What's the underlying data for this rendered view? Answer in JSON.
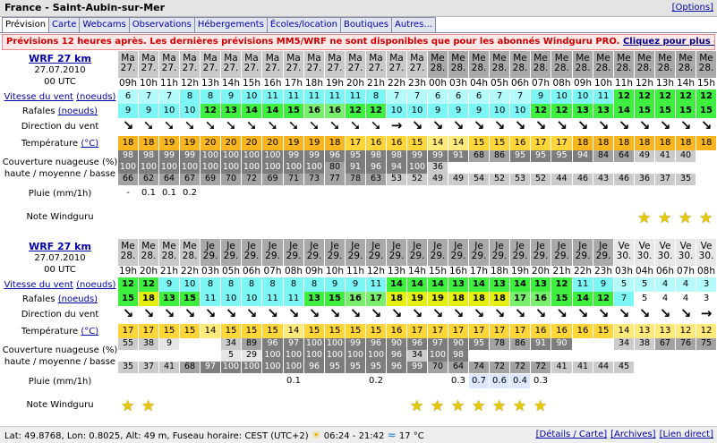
{
  "header": {
    "title": "France - Saint-Aubin-sur-Mer",
    "options_link": "[Options]"
  },
  "tabs": [
    "Prévision",
    "Carte",
    "Webcams",
    "Observations",
    "Hébergements",
    "Écoles/location",
    "Boutiques",
    "Autres..."
  ],
  "notice": {
    "text": "Prévisions 12 heures après. Les dernières prévisions MM5/WRF ne sont disponibles que pour les abonnés Windguru PRO. ",
    "link": "Cliquez pour plus d'info."
  },
  "labels": {
    "model": "WRF 27 km",
    "date": "27.07.2010",
    "run": "00 UTC",
    "wind_speed": "Vitesse du vent",
    "wind_unit": "(noeuds)",
    "gusts": "Rafales",
    "gusts_unit": "(noeuds)",
    "direction": "Direction du vent",
    "temperature": "Température",
    "temp_unit": "(°C)",
    "cloud_line1": "Couverture nuageuse (%)",
    "cloud_line2": "haute / moyenne / basse",
    "rain": "Pluie (mm/1h)",
    "rating": "Note Windguru"
  },
  "colors": {
    "wind_cyan": "#7cf5f5",
    "wind_light": "#b5fbfb",
    "wind_green": "#3fef3f",
    "wind_lime": "#79f06d",
    "gust_yellow": "#e6f00e",
    "temp_orange": "#f7b51f",
    "temp_yellow": "#ffd639",
    "cloud_dark": "#7d7d7d",
    "cloud_mid": "#a2a2a2",
    "cloud_light": "#cbcbcb",
    "star": "#e6c800"
  },
  "forecast1": {
    "days": [
      "Ma",
      "Ma",
      "Ma",
      "Ma",
      "Ma",
      "Ma",
      "Ma",
      "Ma",
      "Ma",
      "Ma",
      "Ma",
      "Ma",
      "Ma",
      "Ma",
      "Ma",
      "Me",
      "Me",
      "Me",
      "Me",
      "Me",
      "Me",
      "Me",
      "Me",
      "Me",
      "Me",
      "Me",
      "Me",
      "Me",
      "Me"
    ],
    "dates": [
      "27.",
      "27.",
      "27.",
      "27.",
      "27.",
      "27.",
      "27.",
      "27.",
      "27.",
      "27.",
      "27.",
      "27.",
      "27.",
      "27.",
      "27.",
      "28.",
      "28.",
      "28.",
      "28.",
      "28.",
      "28.",
      "28.",
      "28.",
      "28.",
      "28.",
      "28.",
      "28.",
      "28.",
      "28."
    ],
    "hours": [
      "09h",
      "10h",
      "11h",
      "12h",
      "13h",
      "14h",
      "15h",
      "16h",
      "17h",
      "18h",
      "19h",
      "20h",
      "21h",
      "22h",
      "23h",
      "00h",
      "03h",
      "04h",
      "05h",
      "06h",
      "07h",
      "08h",
      "09h",
      "10h",
      "11h",
      "12h",
      "13h",
      "14h",
      "15h"
    ],
    "wind": [
      "6",
      "7",
      "7",
      "8",
      "8",
      "9",
      "10",
      "11",
      "11",
      "11",
      "11",
      "11",
      "8",
      "7",
      "7",
      "6",
      "6",
      "6",
      "7",
      "7",
      "9",
      "10",
      "10",
      "11",
      "12",
      "12",
      "12",
      "12",
      "12"
    ],
    "gusts": [
      "9",
      "9",
      "10",
      "10",
      "12",
      "13",
      "14",
      "14",
      "15",
      "16",
      "16",
      "12",
      "12",
      "10",
      "10",
      "9",
      "9",
      "9",
      "10",
      "10",
      "12",
      "12",
      "13",
      "13",
      "14",
      "15",
      "15",
      "15",
      "15"
    ],
    "directions": [
      "↘",
      "➘",
      "➘",
      "➘",
      "➘",
      "➘",
      "➘",
      "➘",
      "➘",
      "➘",
      "➘",
      "➘",
      "➘",
      "→",
      "↘",
      "↘",
      "↘",
      "↘",
      "↘",
      "↘",
      "↘",
      "↘",
      "↘",
      "↘",
      "↘",
      "↘",
      "↘",
      "↘",
      "↘"
    ],
    "temperature": [
      "18",
      "18",
      "19",
      "19",
      "20",
      "20",
      "20",
      "20",
      "19",
      "19",
      "18",
      "17",
      "16",
      "16",
      "15",
      "14",
      "14",
      "15",
      "15",
      "16",
      "17",
      "17",
      "18",
      "18",
      "18",
      "18",
      "18",
      "18",
      "18"
    ],
    "cloud_high": [
      "98",
      "98",
      "99",
      "99",
      "100",
      "100",
      "100",
      "100",
      "99",
      "99",
      "96",
      "95",
      "98",
      "98",
      "99",
      "99",
      "91",
      "68",
      "86",
      "95",
      "95",
      "95",
      "94",
      "84",
      "64",
      "49",
      "41",
      "40",
      ""
    ],
    "cloud_mid": [
      "100",
      "100",
      "100",
      "100",
      "100",
      "100",
      "100",
      "100",
      "100",
      "100",
      "80",
      "91",
      "96",
      "94",
      "100",
      "36",
      "",
      "",
      "",
      "",
      "",
      "",
      "",
      "",
      "",
      "",
      "",
      "",
      ""
    ],
    "cloud_low": [
      "66",
      "62",
      "64",
      "67",
      "69",
      "70",
      "72",
      "69",
      "71",
      "73",
      "77",
      "78",
      "63",
      "53",
      "52",
      "49",
      "49",
      "54",
      "52",
      "53",
      "52",
      "44",
      "46",
      "43",
      "46",
      "36",
      "37",
      "35",
      ""
    ],
    "rain": [
      "-",
      "0.1",
      "0.1",
      "0.2",
      "",
      "",
      "",
      "",
      "",
      "",
      "",
      "",
      "",
      "",
      "",
      "",
      "",
      "",
      "",
      "",
      "",
      "",
      "",
      "",
      "",
      "",
      "",
      "",
      ""
    ],
    "stars": [
      0,
      0,
      0,
      0,
      0,
      0,
      0,
      0,
      0,
      0,
      0,
      0,
      0,
      0,
      0,
      0,
      0,
      0,
      0,
      0,
      0,
      0,
      0,
      0,
      0,
      1,
      1,
      1,
      1
    ]
  },
  "forecast2": {
    "days": [
      "Me",
      "Me",
      "Me",
      "Me",
      "Je",
      "Je",
      "Je",
      "Je",
      "Je",
      "Je",
      "Je",
      "Je",
      "Je",
      "Je",
      "Je",
      "Je",
      "Je",
      "Je",
      "Je",
      "Je",
      "Je",
      "Je",
      "Je",
      "Je",
      "Ve",
      "Ve",
      "Ve",
      "Ve",
      "Ve"
    ],
    "dates": [
      "28.",
      "28.",
      "28.",
      "28.",
      "29.",
      "29.",
      "29.",
      "29.",
      "29.",
      "29.",
      "29.",
      "29.",
      "29.",
      "29.",
      "29.",
      "29.",
      "29.",
      "29.",
      "29.",
      "29.",
      "29.",
      "29.",
      "29.",
      "29.",
      "30.",
      "30.",
      "30.",
      "30.",
      "30."
    ],
    "hours": [
      "19h",
      "20h",
      "21h",
      "22h",
      "03h",
      "05h",
      "06h",
      "07h",
      "08h",
      "09h",
      "10h",
      "11h",
      "12h",
      "13h",
      "14h",
      "15h",
      "16h",
      "17h",
      "18h",
      "19h",
      "20h",
      "21h",
      "22h",
      "23h",
      "03h",
      "04h",
      "06h",
      "07h",
      "08h"
    ],
    "wind": [
      "12",
      "12",
      "9",
      "10",
      "8",
      "8",
      "8",
      "8",
      "8",
      "8",
      "9",
      "9",
      "11",
      "14",
      "14",
      "14",
      "13",
      "14",
      "13",
      "14",
      "13",
      "12",
      "11",
      "9",
      "5",
      "5",
      "4",
      "4",
      "3"
    ],
    "gusts": [
      "15",
      "18",
      "13",
      "15",
      "11",
      "10",
      "10",
      "11",
      "11",
      "13",
      "15",
      "16",
      "17",
      "18",
      "19",
      "19",
      "18",
      "18",
      "18",
      "17",
      "16",
      "15",
      "14",
      "12",
      "7",
      "5",
      "4",
      "4",
      "3"
    ],
    "directions": [
      "↘",
      "↘",
      "↘",
      "↘",
      "↘",
      "↘",
      "↘",
      "↘",
      "↘",
      "↘",
      "↘",
      "↘",
      "↘",
      "↘",
      "↘",
      "↘",
      "↘",
      "↘",
      "↘",
      "↘",
      "↘",
      "↘",
      "↘",
      "↘",
      "↘",
      "↘",
      "↘",
      "↘",
      "→"
    ],
    "temperature": [
      "17",
      "17",
      "15",
      "15",
      "14",
      "15",
      "15",
      "15",
      "14",
      "15",
      "15",
      "15",
      "15",
      "16",
      "17",
      "17",
      "17",
      "17",
      "17",
      "17",
      "16",
      "16",
      "16",
      "15",
      "14",
      "13",
      "13",
      "12",
      "12"
    ],
    "cloud_high": [
      "55",
      "38",
      "9",
      "",
      "",
      "34",
      "89",
      "96",
      "97",
      "100",
      "100",
      "99",
      "96",
      "90",
      "96",
      "97",
      "90",
      "95",
      "78",
      "86",
      "91",
      "90",
      "",
      "",
      "34",
      "38",
      "67",
      "76",
      "75"
    ],
    "cloud_mid": [
      "",
      "",
      "",
      "",
      "",
      "5",
      "29",
      "100",
      "100",
      "100",
      "100",
      "100",
      "100",
      "96",
      "34",
      "100",
      "98",
      "",
      "",
      "",
      "",
      "",
      "",
      "",
      "",
      "",
      "",
      "",
      ""
    ],
    "cloud_low": [
      "35",
      "37",
      "41",
      "68",
      "97",
      "100",
      "100",
      "100",
      "100",
      "96",
      "95",
      "95",
      "95",
      "96",
      "99",
      "70",
      "64",
      "74",
      "72",
      "72",
      "72",
      "41",
      "41",
      "44",
      "45",
      "",
      "",
      "",
      ""
    ],
    "rain": [
      "",
      "",
      "",
      "",
      "",
      "",
      "",
      "",
      "0.1",
      "",
      "",
      "",
      "0.2",
      "",
      "",
      "",
      "0.3",
      "0.7",
      "0.6",
      "0.4",
      "0.3",
      "",
      "",
      "",
      "",
      "",
      "",
      "",
      ""
    ],
    "stars": [
      1,
      1,
      0,
      0,
      0,
      0,
      0,
      0,
      0,
      0,
      0,
      0,
      0,
      0,
      1,
      1,
      1,
      1,
      1,
      1,
      1,
      0,
      0,
      0,
      0,
      0,
      0,
      0,
      0
    ]
  },
  "footer": {
    "coords": "Lat: 49.8768, Lon: 0.8025, Alt: 49 m, Fuseau horaire: CEST (UTC+2)",
    "sun": "06:24 - 21:42",
    "water_temp": "17 °C",
    "links": [
      "[Détails / Carte]",
      "[Archives]",
      "[Lien direct]"
    ]
  }
}
